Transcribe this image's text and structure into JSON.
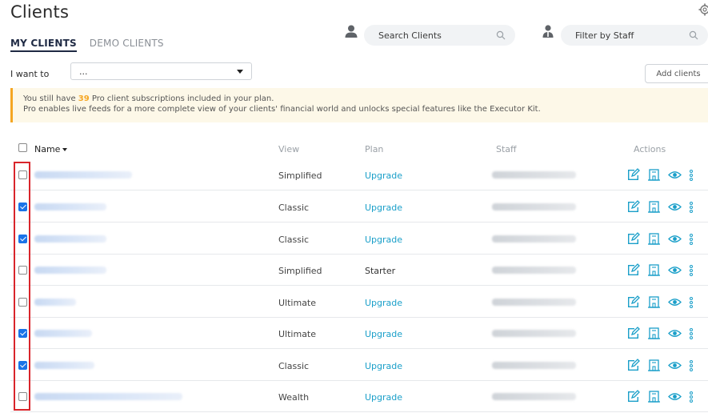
{
  "page": {
    "title": "Clients"
  },
  "tabs": [
    {
      "label": "MY CLIENTS",
      "active": true
    },
    {
      "label": "DEMO CLIENTS",
      "active": false
    }
  ],
  "search": {
    "placeholder": "Search Clients",
    "icon": "search-icon"
  },
  "staff_filter": {
    "placeholder": "Filter by Staff",
    "icon": "search-icon"
  },
  "toolbar": {
    "i_want_to_label": "I want to",
    "action_select_value": "...",
    "add_clients_label": "Add clients"
  },
  "notice": {
    "line1_prefix": "You still have ",
    "count": "39",
    "line1_suffix": " Pro client subscriptions included in your plan.",
    "line2": "Pro enables live feeds for a more complete view of your clients' financial world and unlocks special features like the Executor Kit."
  },
  "table": {
    "headers": {
      "name": "Name",
      "view": "View",
      "plan": "Plan",
      "staff": "Staff",
      "actions": "Actions"
    },
    "rows": [
      {
        "checked": false,
        "view": "Simplified",
        "plan": "Upgrade",
        "plan_is_link": true
      },
      {
        "checked": true,
        "view": "Classic",
        "plan": "Upgrade",
        "plan_is_link": true
      },
      {
        "checked": true,
        "view": "Classic",
        "plan": "Upgrade",
        "plan_is_link": true
      },
      {
        "checked": false,
        "view": "Simplified",
        "plan": "Starter",
        "plan_is_link": false
      },
      {
        "checked": false,
        "view": "Ultimate",
        "plan": "Upgrade",
        "plan_is_link": true
      },
      {
        "checked": true,
        "view": "Ultimate",
        "plan": "Upgrade",
        "plan_is_link": true
      },
      {
        "checked": true,
        "view": "Classic",
        "plan": "Upgrade",
        "plan_is_link": true
      },
      {
        "checked": false,
        "view": "Wealth",
        "plan": "Upgrade",
        "plan_is_link": true
      }
    ],
    "action_icons": [
      "edit-icon",
      "building-icon",
      "eye-icon",
      "more-vertical-icon"
    ]
  },
  "colors": {
    "accent": "#1a9fc9",
    "checkbox": "#1a73e8",
    "notice_bar": "#f5a623",
    "highlight": "#d9252b"
  }
}
